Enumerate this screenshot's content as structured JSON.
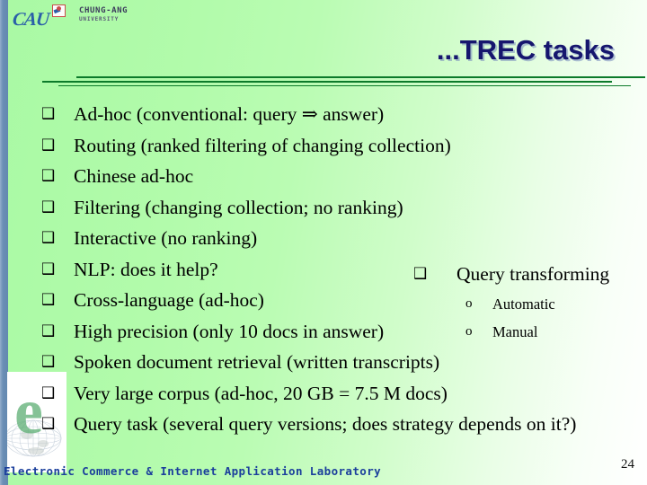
{
  "slide": {
    "page_number": "24",
    "background_color": "#b2fbab",
    "accent_stripe_color": "#6b8fb5",
    "rule_color": "#0c7a2a"
  },
  "header": {
    "logo": {
      "wordmark": "CAU",
      "flag_icon": "cau-flag-icon",
      "university_line1": "CHUNG-ANG",
      "university_line2": "UNIVERSITY"
    },
    "title": "...TREC tasks",
    "title_color": "#16166e"
  },
  "main": {
    "bullet_glyph": "❑",
    "sub_bullet_glyph": "o",
    "bullets": [
      {
        "text": "Ad-hoc (conventional: query ⇒ answer)"
      },
      {
        "text": "Routing (ranked filtering of changing collection)"
      },
      {
        "text": "Chinese ad-hoc"
      },
      {
        "text": "Filtering (changing collection; no ranking)"
      },
      {
        "text": "Interactive (no ranking)"
      },
      {
        "text": "NLP: does it help?"
      },
      {
        "text": "Cross-language (ad-hoc)"
      },
      {
        "text": "High precision (only 10 docs in answer)"
      },
      {
        "text": "Spoken document retrieval (written transcripts)"
      },
      {
        "text": "Very large corpus (ad-hoc, 20 GB = 7.5 M docs)"
      },
      {
        "text": "Query task (several query versions; does strategy depends on it?)"
      }
    ],
    "right_column": {
      "heading": "Query transforming",
      "sub_items": [
        {
          "text": "Automatic"
        },
        {
          "text": "Manual"
        }
      ]
    }
  },
  "footer": {
    "lab_name": "Electronic Commerce & Internet Application Laboratory",
    "lab_color": "#1b3f9c",
    "watermark_letter": "e"
  }
}
